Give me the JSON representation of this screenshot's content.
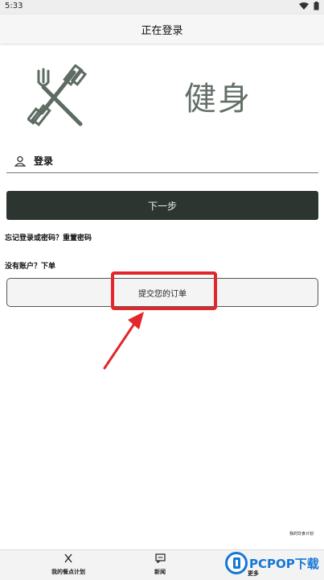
{
  "status_bar": {
    "time": "5:33"
  },
  "app_bar": {
    "title": "正在登录"
  },
  "logo": {
    "text": "健身"
  },
  "login_field": {
    "label": "登录"
  },
  "next_button": {
    "label": "下一步"
  },
  "forgot": {
    "text": "忘记登录或密码？重置密码"
  },
  "no_account": {
    "text": "没有账户？下单"
  },
  "submit_button": {
    "label": "提交您的订单"
  },
  "corner_note": {
    "text": "我的饮食计划"
  },
  "bottom_nav": {
    "items": [
      {
        "label": "我的餐点计划",
        "icon": "fork-knife-icon"
      },
      {
        "label": "新闻",
        "icon": "chat-icon"
      },
      {
        "label": "更多",
        "icon": "more-icon"
      }
    ]
  },
  "watermark": {
    "text": "PCPOP下载"
  },
  "colors": {
    "accent_dark": "#2c3530",
    "highlight_red": "#e3262b",
    "logo_gray": "#637066",
    "watermark_blue": "#1677d6"
  }
}
